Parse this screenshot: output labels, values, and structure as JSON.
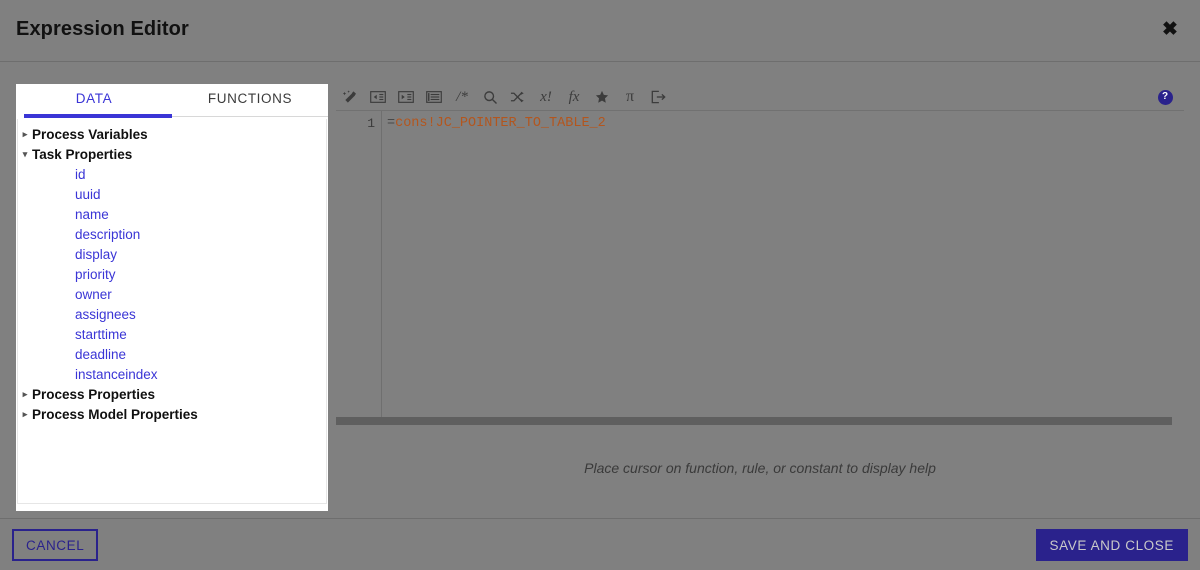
{
  "window": {
    "title": "Expression Editor",
    "close_icon": "close-icon",
    "close_glyph": "✖"
  },
  "left_panel": {
    "tabs": [
      {
        "label": "DATA",
        "active": true
      },
      {
        "label": "FUNCTIONS",
        "active": false
      }
    ],
    "tree": [
      {
        "label": "Process Variables",
        "type": "parent",
        "expanded": false,
        "caret": "▸"
      },
      {
        "label": "Task Properties",
        "type": "parent",
        "expanded": true,
        "caret": "▾"
      },
      {
        "label": "id",
        "type": "child"
      },
      {
        "label": "uuid",
        "type": "child"
      },
      {
        "label": "name",
        "type": "child"
      },
      {
        "label": "description",
        "type": "child"
      },
      {
        "label": "display",
        "type": "child"
      },
      {
        "label": "priority",
        "type": "child"
      },
      {
        "label": "owner",
        "type": "child"
      },
      {
        "label": "assignees",
        "type": "child"
      },
      {
        "label": "starttime",
        "type": "child"
      },
      {
        "label": "deadline",
        "type": "child"
      },
      {
        "label": "instanceindex",
        "type": "child"
      },
      {
        "label": "Process Properties",
        "type": "parent",
        "expanded": false,
        "caret": "▸"
      },
      {
        "label": "Process Model Properties",
        "type": "parent",
        "expanded": false,
        "caret": "▸"
      }
    ]
  },
  "editor": {
    "toolbar": [
      {
        "name": "format-magic-wand-icon",
        "glyph": ""
      },
      {
        "name": "outdent-icon",
        "glyph": ""
      },
      {
        "name": "indent-icon",
        "glyph": ""
      },
      {
        "name": "align-icon",
        "glyph": ""
      },
      {
        "name": "comment-icon",
        "glyph": "/*"
      },
      {
        "name": "search-icon",
        "glyph": ""
      },
      {
        "name": "shuffle-icon",
        "glyph": ""
      },
      {
        "name": "variable-icon",
        "glyph": "x!"
      },
      {
        "name": "function-icon",
        "glyph": "fx"
      },
      {
        "name": "favorite-star-icon",
        "glyph": "★"
      },
      {
        "name": "constant-pi-icon",
        "glyph": "π"
      },
      {
        "name": "export-icon",
        "glyph": ""
      }
    ],
    "help_icon": "help-icon",
    "help_icon_glyph": "?",
    "gutter": {
      "line_numbers": [
        "1"
      ]
    },
    "code": {
      "lines": [
        {
          "number": "1",
          "prefix": "=",
          "token": "cons!JC_POINTER_TO_TABLE_2"
        }
      ],
      "full_text": "=cons!JC_POINTER_TO_TABLE_2"
    },
    "help_message": "Place cursor on function, rule, or constant to display help"
  },
  "footer": {
    "cancel_label": "CANCEL",
    "save_label": "SAVE AND CLOSE"
  },
  "colors": {
    "background": "#808080",
    "accent_blue": "#3a35d6",
    "button_navy": "#2a228c",
    "code_constant": "#b3561e",
    "panel_white": "#ffffff"
  }
}
